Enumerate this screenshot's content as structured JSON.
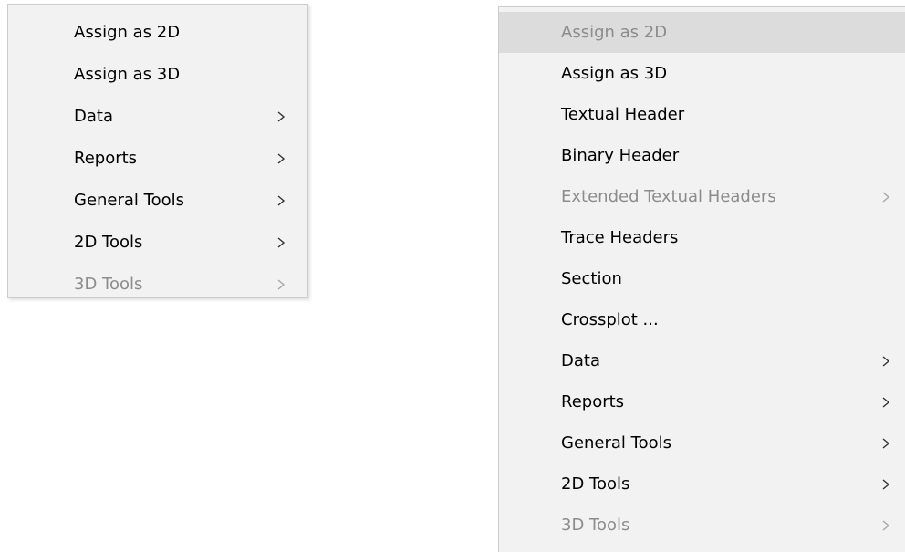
{
  "left_menu": {
    "items": [
      {
        "label": "Assign as 2D",
        "submenu": false,
        "disabled": false
      },
      {
        "label": "Assign as 3D",
        "submenu": false,
        "disabled": false
      },
      {
        "label": "Data",
        "submenu": true,
        "disabled": false
      },
      {
        "label": "Reports",
        "submenu": true,
        "disabled": false
      },
      {
        "label": "General Tools",
        "submenu": true,
        "disabled": false
      },
      {
        "label": "2D Tools",
        "submenu": true,
        "disabled": false
      },
      {
        "label": "3D Tools",
        "submenu": true,
        "disabled": true
      }
    ]
  },
  "right_menu": {
    "items": [
      {
        "label": "Assign as 2D",
        "submenu": false,
        "disabled": true,
        "highlighted": true
      },
      {
        "label": "Assign as 3D",
        "submenu": false,
        "disabled": false
      },
      {
        "label": "Textual Header",
        "submenu": false,
        "disabled": false
      },
      {
        "label": "Binary Header",
        "submenu": false,
        "disabled": false
      },
      {
        "label": "Extended Textual Headers",
        "submenu": true,
        "disabled": true
      },
      {
        "label": "Trace Headers",
        "submenu": false,
        "disabled": false
      },
      {
        "label": "Section",
        "submenu": false,
        "disabled": false
      },
      {
        "label": "Crossplot ...",
        "submenu": false,
        "disabled": false
      },
      {
        "label": "Data",
        "submenu": true,
        "disabled": false
      },
      {
        "label": "Reports",
        "submenu": true,
        "disabled": false
      },
      {
        "label": "General Tools",
        "submenu": true,
        "disabled": false
      },
      {
        "label": "2D Tools",
        "submenu": true,
        "disabled": false
      },
      {
        "label": "3D Tools",
        "submenu": true,
        "disabled": true
      }
    ]
  },
  "colors": {
    "menu_background": "#f2f2f2",
    "highlight": "#dcdcdc",
    "disabled_text": "#8c8c8c",
    "text": "#000000"
  },
  "icons": {
    "submenu_arrow": "chevron-right-icon"
  }
}
